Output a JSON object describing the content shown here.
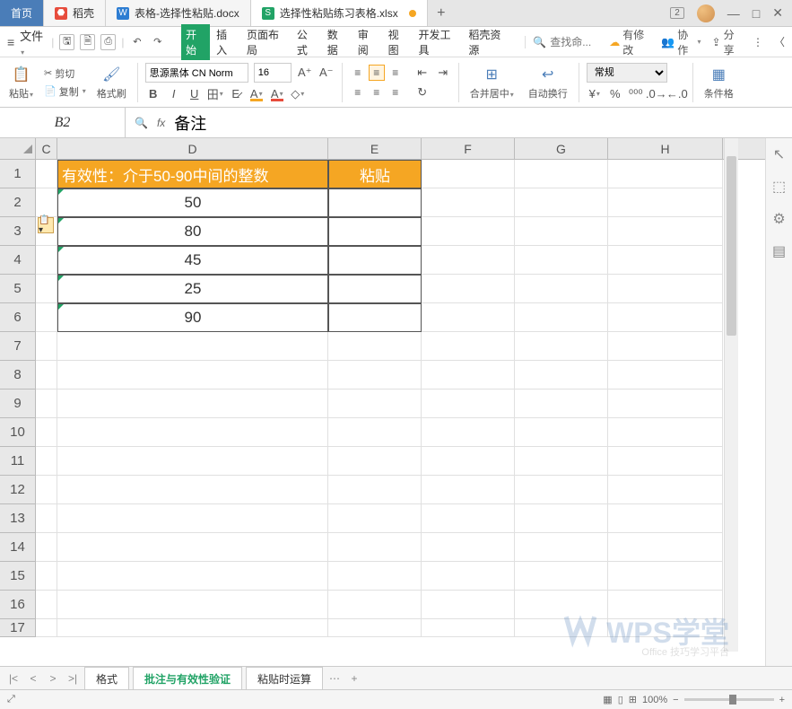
{
  "tabs": {
    "home": "首页",
    "t1": "稻壳",
    "t2": "表格-选择性粘贴.docx",
    "t3": "选择性粘贴练习表格.xlsx"
  },
  "win": {
    "badge": "2"
  },
  "menu": {
    "file": "文件",
    "items": [
      "开始",
      "插入",
      "页面布局",
      "公式",
      "数据",
      "审阅",
      "视图",
      "开发工具",
      "稻壳资源"
    ],
    "search_ph": "查找命...",
    "changes": "有修改",
    "coop": "协作",
    "share": "分享"
  },
  "ribbon": {
    "paste": "粘贴",
    "cut": "剪切",
    "copy": "复制",
    "brush": "格式刷",
    "font_name": "思源黑体 CN Norm",
    "font_size": "16",
    "merge": "合并居中",
    "wrap": "自动换行",
    "numfmt": "常规",
    "cond": "条件格"
  },
  "namebox": "B2",
  "fx_value": "备注",
  "cols": {
    "C_w": 24,
    "D_w": 302,
    "E_w": 104,
    "F_w": 104,
    "G_w": 104,
    "H_w": 104
  },
  "header": {
    "d1": "有效性：介于50-90中间的整数",
    "e1": "粘贴"
  },
  "rows": [
    {
      "d": "50"
    },
    {
      "d": "80"
    },
    {
      "d": "45"
    },
    {
      "d": "25"
    },
    {
      "d": "90"
    }
  ],
  "sheets": {
    "s1": "格式",
    "s2": "批注与有效性验证",
    "s3": "粘贴时运算"
  },
  "status": {
    "zoom": "100%"
  },
  "watermark": "WPS学堂",
  "watermark_sub": "Office 技巧学习平台"
}
